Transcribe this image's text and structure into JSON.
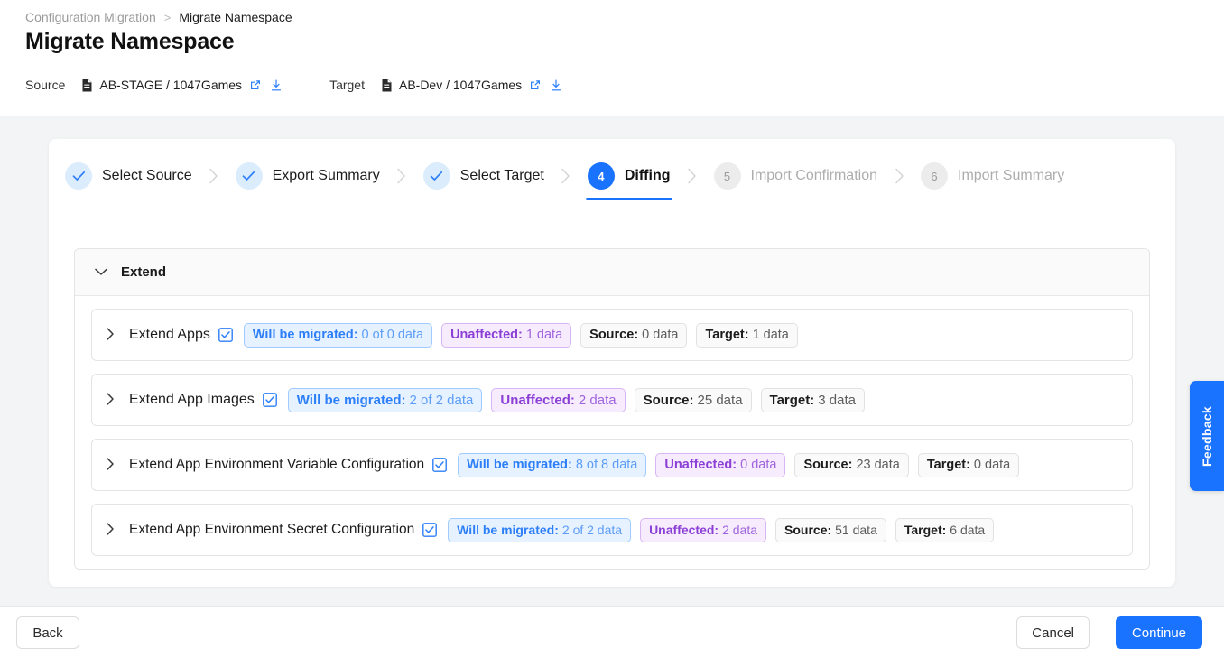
{
  "breadcrumb": {
    "parent": "Configuration Migration",
    "separator": ">",
    "current": "Migrate Namespace"
  },
  "page_title": "Migrate Namespace",
  "env": {
    "source_label": "Source",
    "source_value": "AB-STAGE / 1047Games",
    "target_label": "Target",
    "target_value": "AB-Dev / 1047Games",
    "doc_icon": "document-icon",
    "external_icon": "external-link-icon",
    "download_icon": "download-icon"
  },
  "stepper": {
    "steps": [
      {
        "number": "1",
        "label": "Select Source",
        "state": "done",
        "mark": "✓"
      },
      {
        "number": "2",
        "label": "Export Summary",
        "state": "done",
        "mark": "✓"
      },
      {
        "number": "3",
        "label": "Select Target",
        "state": "done",
        "mark": "✓"
      },
      {
        "number": "4",
        "label": "Diffing",
        "state": "active",
        "mark": "4"
      },
      {
        "number": "5",
        "label": "Import Confirmation",
        "state": "todo",
        "mark": "5"
      },
      {
        "number": "6",
        "label": "Import Summary",
        "state": "todo",
        "mark": "6"
      }
    ]
  },
  "section": {
    "title": "Extend",
    "expanded": true,
    "rows": [
      {
        "name": "Extend Apps",
        "checked": true,
        "badges": [
          {
            "kind": "migrated",
            "label": "Will be migrated:",
            "value": "0 of 0 data"
          },
          {
            "kind": "unaffected",
            "label": "Unaffected:",
            "value": "1 data"
          },
          {
            "kind": "plain",
            "label": "Source:",
            "value": "0 data"
          },
          {
            "kind": "plain",
            "label": "Target:",
            "value": "1 data"
          }
        ]
      },
      {
        "name": "Extend App Images",
        "checked": true,
        "badges": [
          {
            "kind": "migrated",
            "label": "Will be migrated:",
            "value": "2 of 2 data"
          },
          {
            "kind": "unaffected",
            "label": "Unaffected:",
            "value": "2 data"
          },
          {
            "kind": "plain",
            "label": "Source:",
            "value": "25 data"
          },
          {
            "kind": "plain",
            "label": "Target:",
            "value": "3 data"
          }
        ]
      },
      {
        "name": "Extend App Environment Variable Configuration",
        "checked": true,
        "badges": [
          {
            "kind": "migrated",
            "label": "Will be migrated:",
            "value": "8 of 8 data"
          },
          {
            "kind": "unaffected",
            "label": "Unaffected:",
            "value": "0 data"
          },
          {
            "kind": "plain",
            "label": "Source:",
            "value": "23 data"
          },
          {
            "kind": "plain",
            "label": "Target:",
            "value": "0 data"
          }
        ]
      },
      {
        "name": "Extend App Environment Secret Configuration",
        "checked": true,
        "badges": [
          {
            "kind": "migrated",
            "label": "Will be migrated:",
            "value": "2 of 2 data"
          },
          {
            "kind": "unaffected",
            "label": "Unaffected:",
            "value": "2 data"
          },
          {
            "kind": "plain",
            "label": "Source:",
            "value": "51 data"
          },
          {
            "kind": "plain",
            "label": "Target:",
            "value": "6 data"
          }
        ]
      }
    ]
  },
  "feedback": {
    "label": "Feedback"
  },
  "footer": {
    "back": "Back",
    "cancel": "Cancel",
    "continue": "Continue"
  },
  "colors": {
    "accent": "#1a73ff",
    "migrated": "#2d7ff9",
    "unaffected": "#8c3fd6",
    "page_bg": "#f3f4f5"
  }
}
